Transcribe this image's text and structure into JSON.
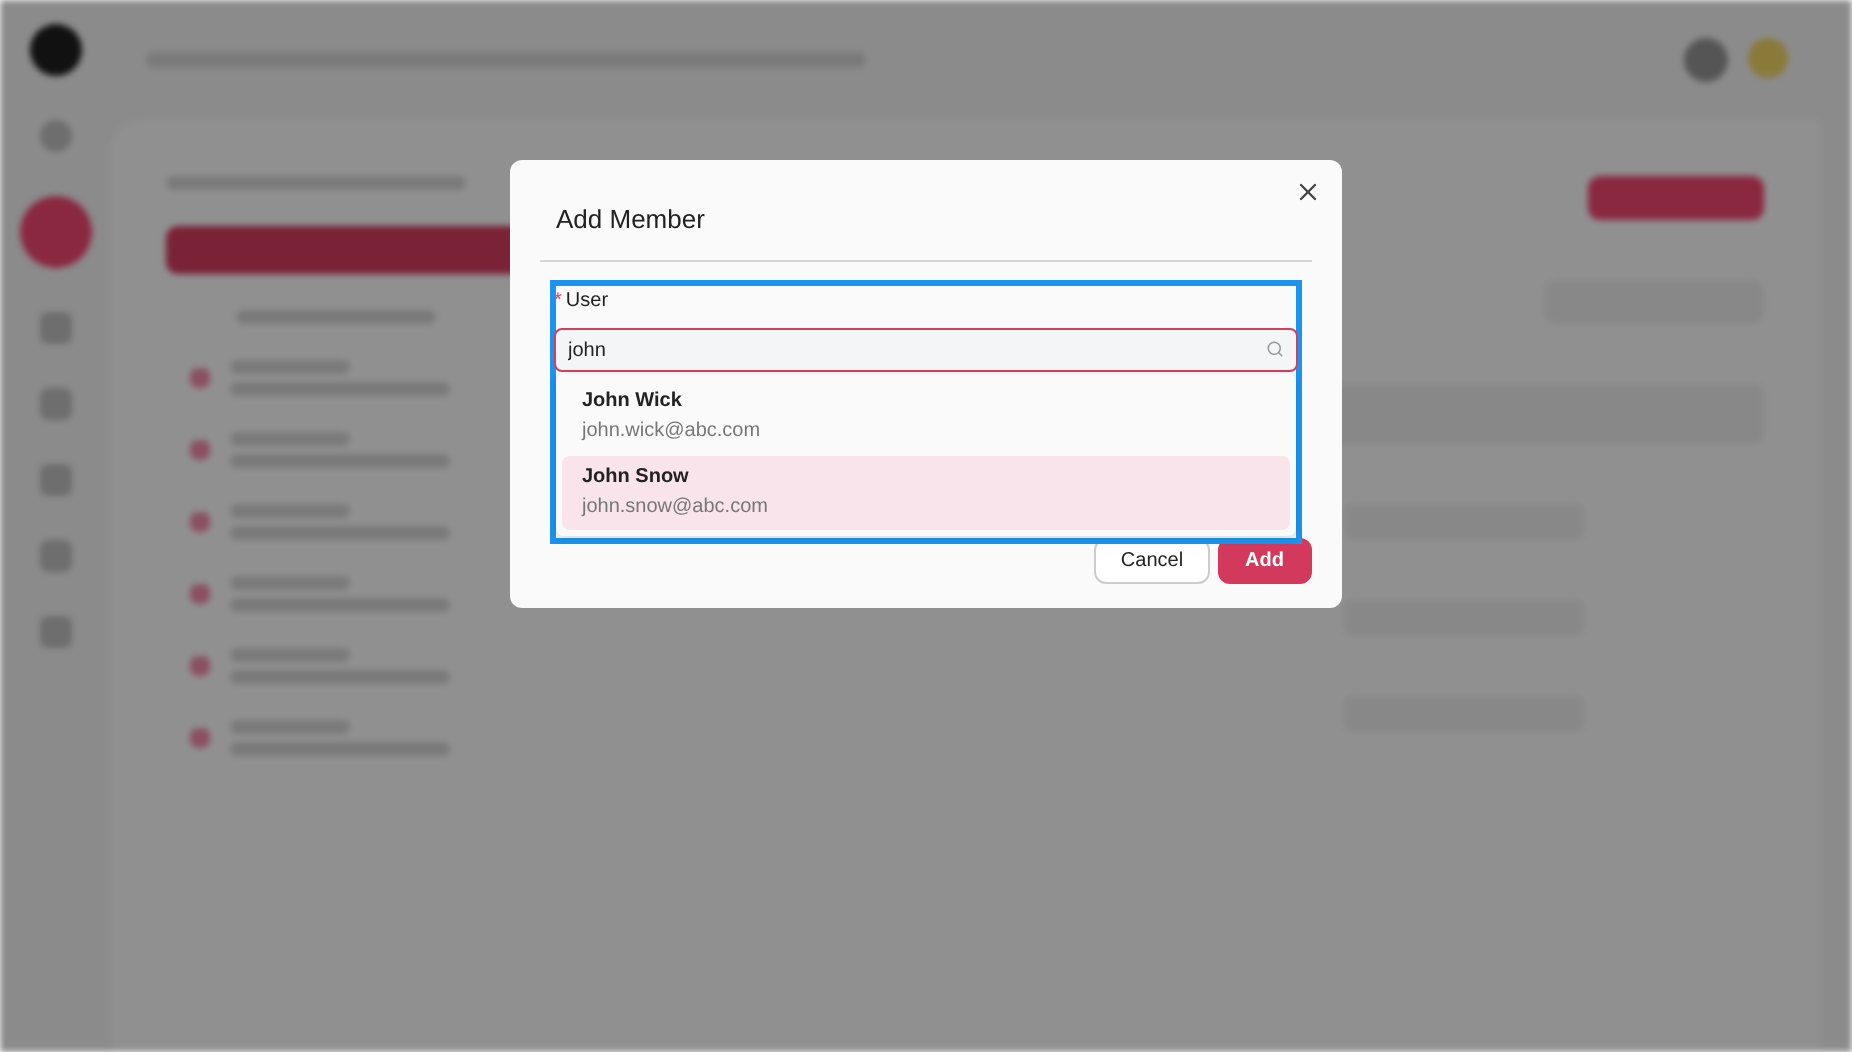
{
  "dialog": {
    "title": "Add Member",
    "field": {
      "label": "User",
      "required": true,
      "required_mark": "*",
      "value": "john"
    },
    "options": [
      {
        "name": "John Wick",
        "email": "john.wick@abc.com",
        "selected": false
      },
      {
        "name": "John Snow",
        "email": "john.snow@abc.com",
        "selected": true
      }
    ],
    "buttons": [
      {
        "label": "Cancel",
        "kind": "secondary"
      },
      {
        "label": "Add",
        "kind": "primary"
      }
    ]
  }
}
